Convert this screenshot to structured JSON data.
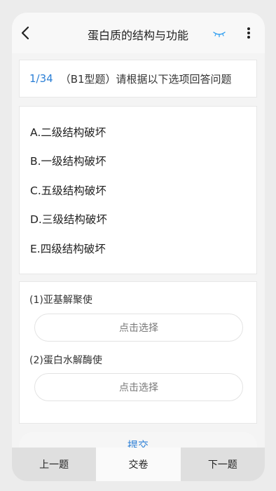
{
  "header": {
    "title": "蛋白质的结构与功能"
  },
  "question": {
    "number": "1/34",
    "text": "（B1型题）请根据以下选项回答问题"
  },
  "options": [
    "A.二级结构破坏",
    "B.一级结构破坏",
    "C.五级结构破坏",
    "D.三级结构破坏",
    "E.四级结构破坏"
  ],
  "sub_questions": [
    {
      "label": "(1)亚基解聚使",
      "select_text": "点击选择"
    },
    {
      "label": "(2)蛋白水解酶使",
      "select_text": "点击选择"
    }
  ],
  "submit_label": "提交",
  "bottom_nav": {
    "prev": "上一题",
    "submit_exam": "交卷",
    "next": "下一题"
  },
  "colors": {
    "accent": "#2b7fd6",
    "bottom_side_bg": "#dfdfdf"
  }
}
